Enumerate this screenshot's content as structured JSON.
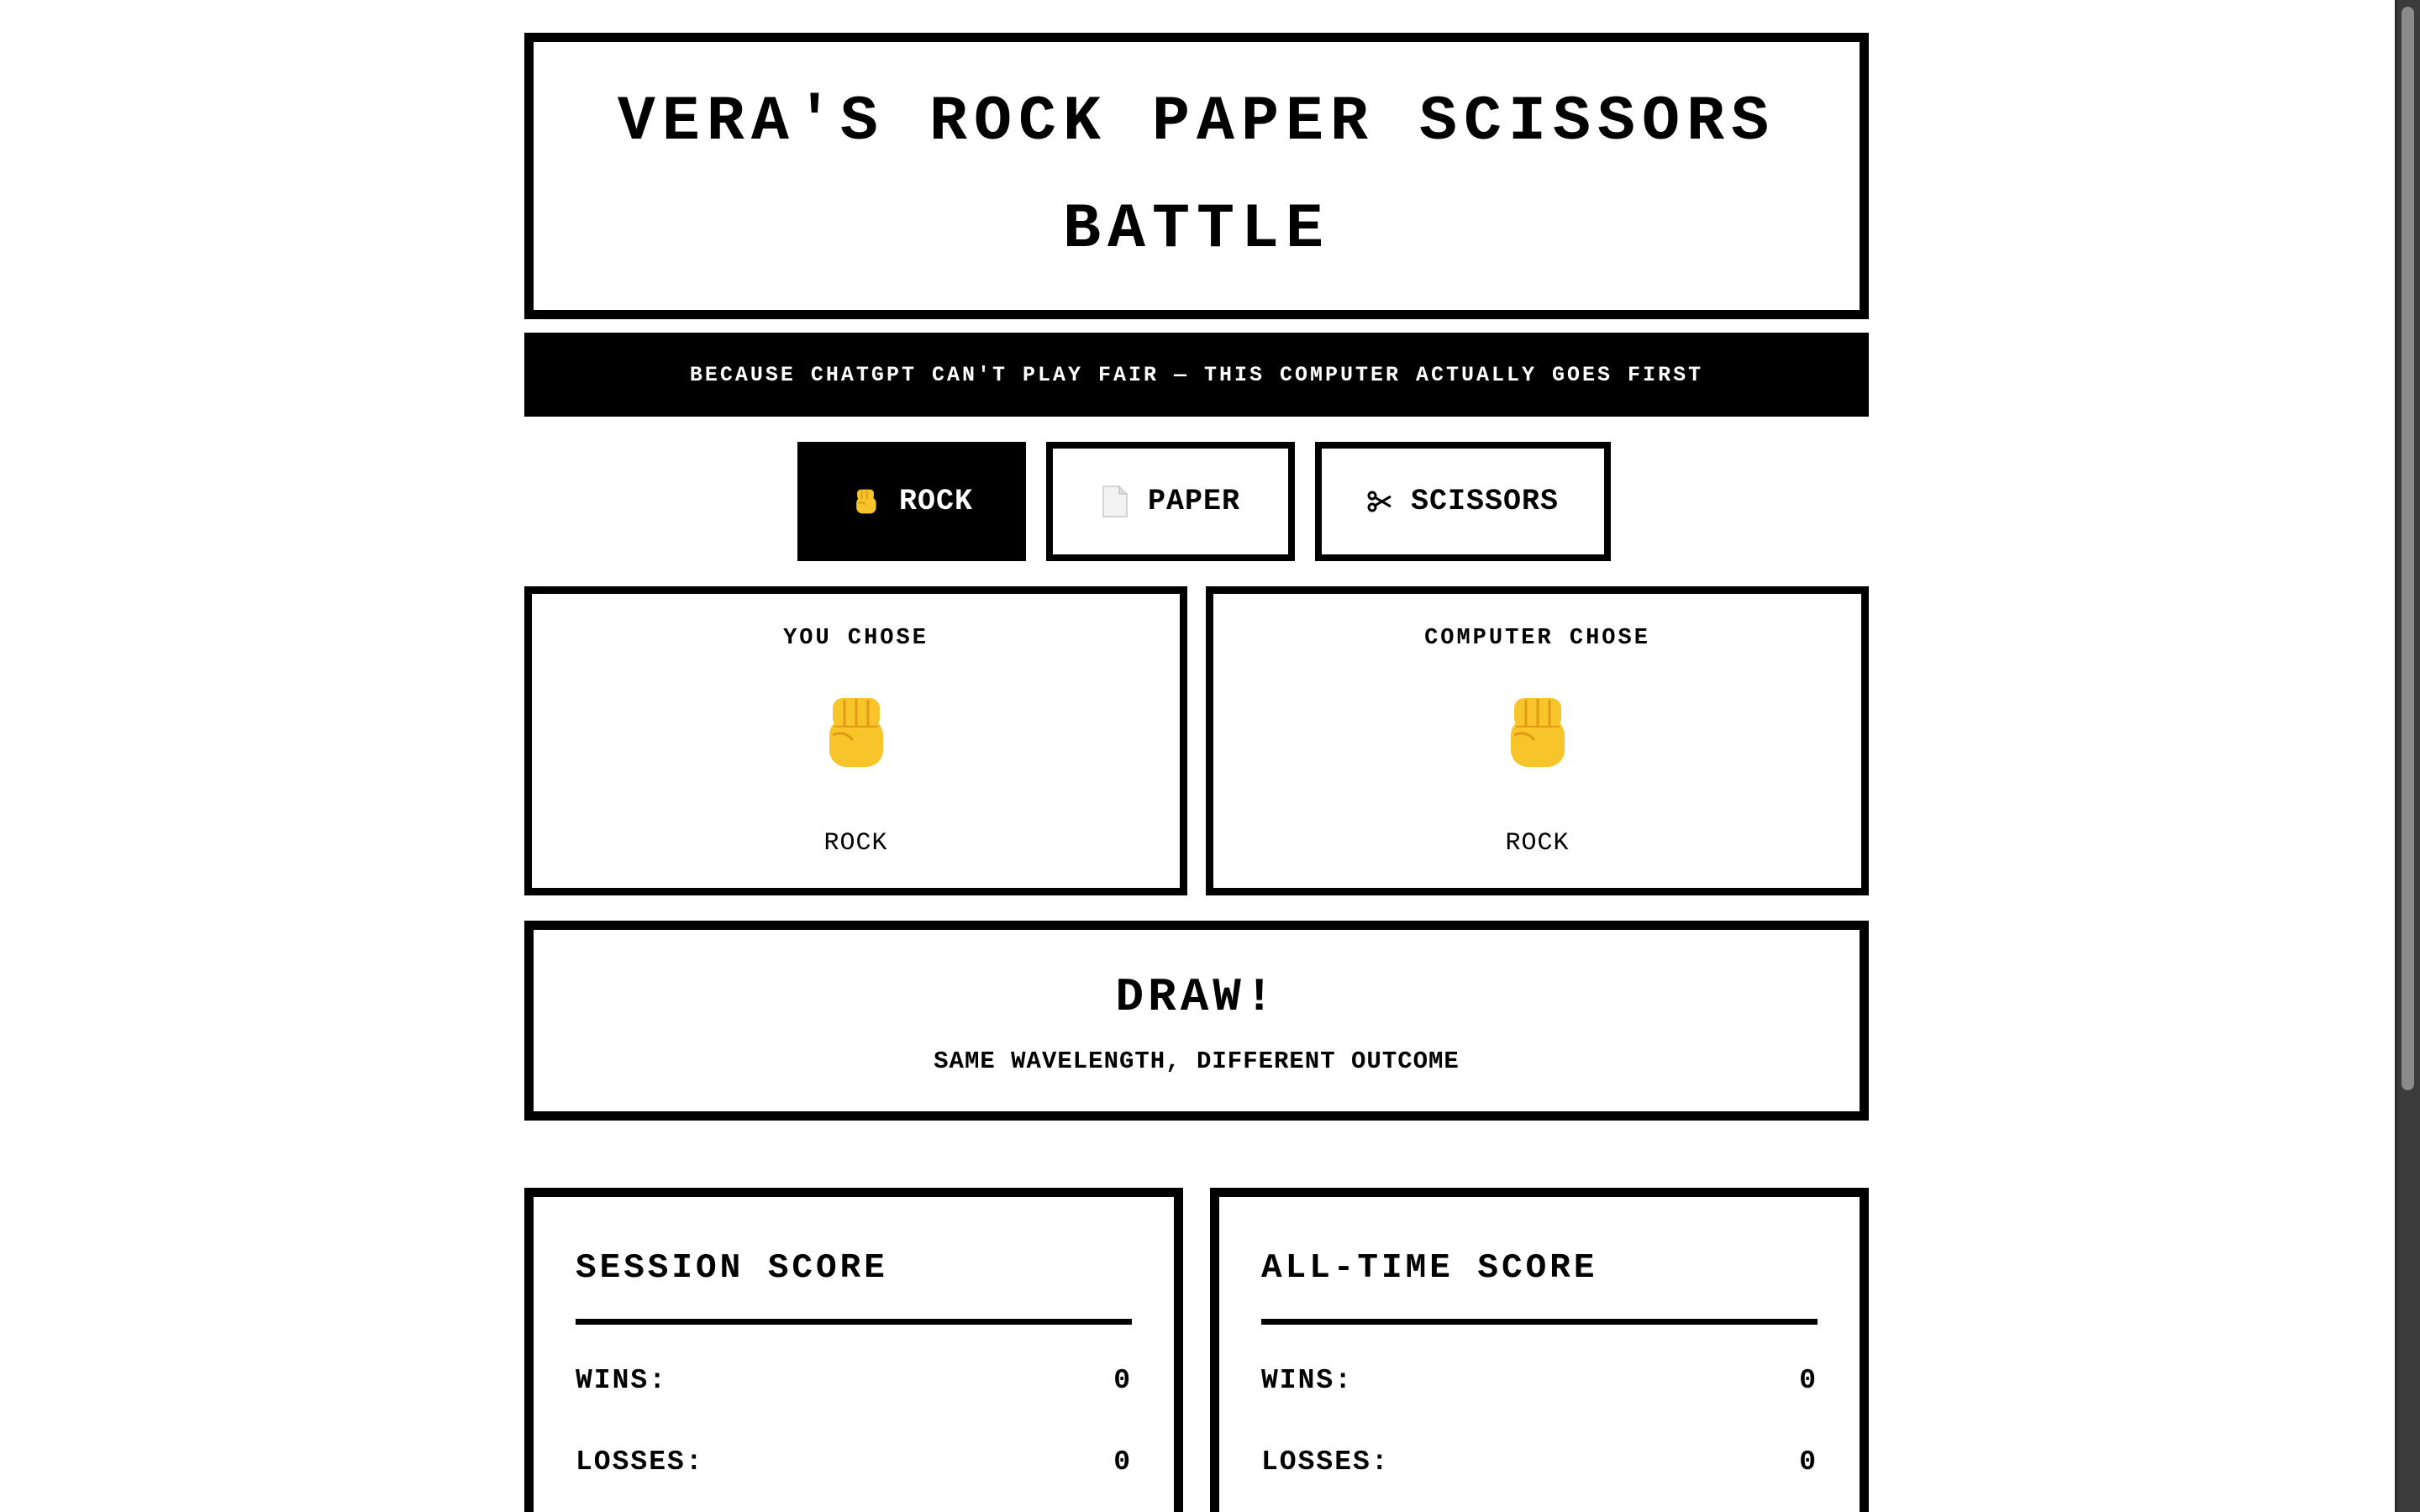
{
  "header": {
    "title_line1": "VERA'S ROCK PAPER SCISSORS",
    "title_line2": "BATTLE",
    "tagline": "BECAUSE CHATGPT CAN'T PLAY FAIR — THIS COMPUTER ACTUALLY GOES FIRST"
  },
  "choices": [
    {
      "label": "ROCK",
      "icon": "raised-fist-icon",
      "selected": true
    },
    {
      "label": "PAPER",
      "icon": "page-icon",
      "selected": false
    },
    {
      "label": "SCISSORS",
      "icon": "scissors-icon",
      "selected": false
    }
  ],
  "player": {
    "label": "YOU CHOSE",
    "choice": "ROCK",
    "icon": "raised-fist-icon"
  },
  "computer": {
    "label": "COMPUTER CHOSE",
    "choice": "ROCK",
    "icon": "raised-fist-icon"
  },
  "result": {
    "headline": "DRAW!",
    "message": "SAME WAVELENGTH, DIFFERENT OUTCOME"
  },
  "session_score": {
    "title": "SESSION SCORE",
    "wins_label": "WINS:",
    "wins": "0",
    "losses_label": "LOSSES:",
    "losses": "0"
  },
  "alltime_score": {
    "title": "ALL-TIME SCORE",
    "wins_label": "WINS:",
    "wins": "0",
    "losses_label": "LOSSES:",
    "losses": "0"
  },
  "colors": {
    "ink": "#000000",
    "paper": "#ffffff",
    "fist_fill": "#f7c52a",
    "fist_shade": "#e09a16"
  }
}
